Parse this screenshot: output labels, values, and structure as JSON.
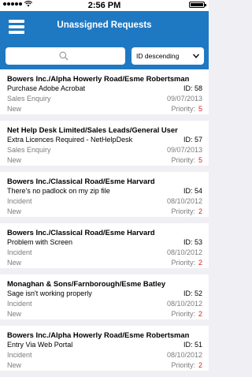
{
  "status_bar": {
    "time": "2:56 PM"
  },
  "header": {
    "title": "Unassigned Requests"
  },
  "search": {
    "placeholder": ""
  },
  "sort": {
    "selected": "ID descending"
  },
  "labels": {
    "id_prefix": "ID:",
    "priority_prefix": "Priority:"
  },
  "requests": [
    {
      "title": "Bowers Inc./Alpha Howerly Road/Esme Robertsman",
      "summary": "Purchase Adobe Acrobat",
      "id": "58",
      "type": "Sales Enquiry",
      "date": "09/07/2013",
      "status": "New",
      "priority": "5"
    },
    {
      "title": "Net Help Desk Limited/Sales Leads/General User",
      "summary": "Extra Licences Required - NetHelpDesk",
      "id": "57",
      "type": "Sales Enquiry",
      "date": "09/07/2013",
      "status": "New",
      "priority": "5"
    },
    {
      "title": "Bowers Inc./Classical Road/Esme Harvard",
      "summary": "There's no padlock on my zip file",
      "id": "54",
      "type": "Incident",
      "date": "08/10/2012",
      "status": "New",
      "priority": "2"
    },
    {
      "title": "Bowers Inc./Classical Road/Esme Harvard",
      "summary": "Problem with Screen",
      "id": "53",
      "type": "Incident",
      "date": "08/10/2012",
      "status": "New",
      "priority": "2"
    },
    {
      "title": "Monaghan & Sons/Farnborough/Esme Batley",
      "summary": "Sage isn't working properly",
      "id": "52",
      "type": "Incident",
      "date": "08/10/2012",
      "status": "New",
      "priority": "2"
    },
    {
      "title": "Bowers Inc./Alpha Howerly Road/Esme Robertsman",
      "summary": "Entry Via Web Portal",
      "id": "51",
      "type": "Incident",
      "date": "08/10/2012",
      "status": "New",
      "priority": "2"
    }
  ],
  "colors": {
    "header": "#1f79c2",
    "priority": "#e02020"
  }
}
